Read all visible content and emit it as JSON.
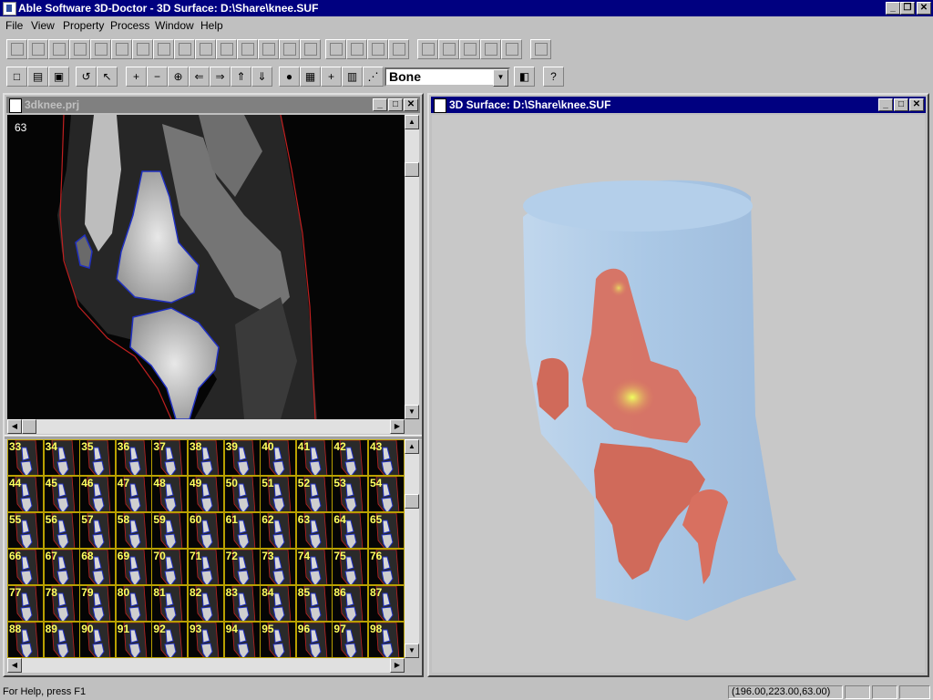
{
  "app": {
    "title": "Able Software 3D-Doctor - 3D Surface: D:\\Share\\knee.SUF",
    "caption_buttons": [
      "_",
      "❐",
      "✕"
    ]
  },
  "menu": [
    {
      "label": "File",
      "key": "F"
    },
    {
      "label": "View",
      "key": "V"
    },
    {
      "label": "Property",
      "key": "P"
    },
    {
      "label": "Process",
      "key": "P"
    },
    {
      "label": "Window",
      "key": "W"
    },
    {
      "label": "Help",
      "key": "H"
    }
  ],
  "toolbar2": {
    "combo_value": "Bone"
  },
  "left_window": {
    "title": "3dknee.prj",
    "slice_number": "63",
    "thumbnails": [
      "33",
      "34",
      "35",
      "36",
      "37",
      "38",
      "39",
      "40",
      "41",
      "42",
      "43",
      "44",
      "45",
      "46",
      "47",
      "48",
      "49",
      "50",
      "51",
      "52",
      "53",
      "54",
      "55",
      "56",
      "57",
      "58",
      "59",
      "60",
      "61",
      "62",
      "63",
      "64",
      "65",
      "66",
      "67",
      "68",
      "69",
      "70",
      "71",
      "72",
      "73",
      "74",
      "75",
      "76",
      "77",
      "78",
      "79",
      "80",
      "81",
      "82",
      "83",
      "84",
      "85",
      "86",
      "87",
      "88",
      "89",
      "90",
      "91",
      "92",
      "93",
      "94",
      "95",
      "96",
      "97",
      "98"
    ]
  },
  "right_window": {
    "title": "3D Surface: D:\\Share\\knee.SUF"
  },
  "status": {
    "help": "For Help, press F1",
    "coords": "(196.00,223.00,63.00)"
  },
  "colors": {
    "title_active": "#000080",
    "title_inactive": "#808080",
    "viewport_bg": "#c8c8c8",
    "tissue": "#a8c8e8",
    "bone": "#d87060",
    "contour_bone": "#2030c0",
    "contour_skin": "#c02020"
  }
}
